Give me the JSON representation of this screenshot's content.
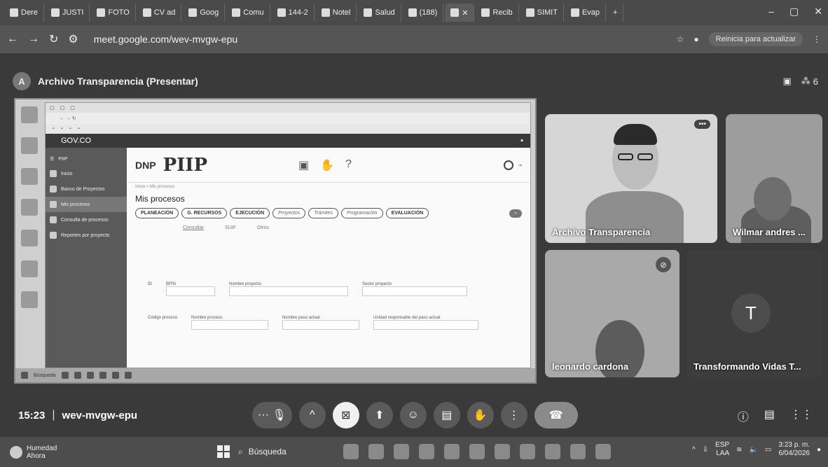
{
  "browser": {
    "tabs": [
      "Dere",
      "JUSTI",
      "FOTO",
      "CV ad",
      "Goog",
      "Comu",
      "144-2",
      "Notel",
      "Salud",
      "(188)",
      "",
      "Recib",
      "SIMIT",
      "Evap"
    ],
    "url": "meet.google.com/wev-mvgw-epu",
    "reload_label": "Reinicia para actualizar"
  },
  "meet": {
    "presenter_initial": "A",
    "title": "Archivo Transparencia (Presentar)",
    "participant_count": "6",
    "time": "15:23",
    "meeting_code": "wev-mvgw-epu"
  },
  "shared_screen": {
    "gov_label": "GOV.CO",
    "side_title": "PIIP",
    "side_items": [
      "Inicio",
      "Banco de Proyectos",
      "Mis procesos",
      "Consulta de procesos",
      "Reportes por proyecto"
    ],
    "logo_dnp": "DNP",
    "logo_piip": "PIIP",
    "page_title": "Mis procesos",
    "breadcrumb": "Inicio > Mis procesos",
    "steps": [
      "PLANEACIÓN",
      "G. RECURSOS",
      "EJECUCIÓN",
      "Proyectos",
      "Trámites",
      "Programación",
      "EVALUACIÓN"
    ],
    "subtabs": [
      "Consultar",
      "SUIF",
      "Otros"
    ],
    "filter_labels": [
      "ID",
      "BPIN",
      "Nombre proyecto",
      "Sector proyecto",
      "Código proceso",
      "Nombre proceso",
      "Nombre paso actual",
      "Unidad responsable del paso actual"
    ],
    "taskbar_label": "Búsqueda"
  },
  "tiles": [
    {
      "name": "Archivo Transparencia"
    },
    {
      "name": "Wilmar andres ..."
    },
    {
      "name": "leonardo cardona"
    },
    {
      "name": "Transformando Vidas T...",
      "initial": "T"
    }
  ],
  "os": {
    "weather_title": "Humedad",
    "weather_sub": "Ahora",
    "search_label": "Búsqueda",
    "lang_top": "ESP",
    "lang_bottom": "LAA",
    "clock_time": "3:23 p. m.",
    "clock_date": "6/04/2026"
  }
}
